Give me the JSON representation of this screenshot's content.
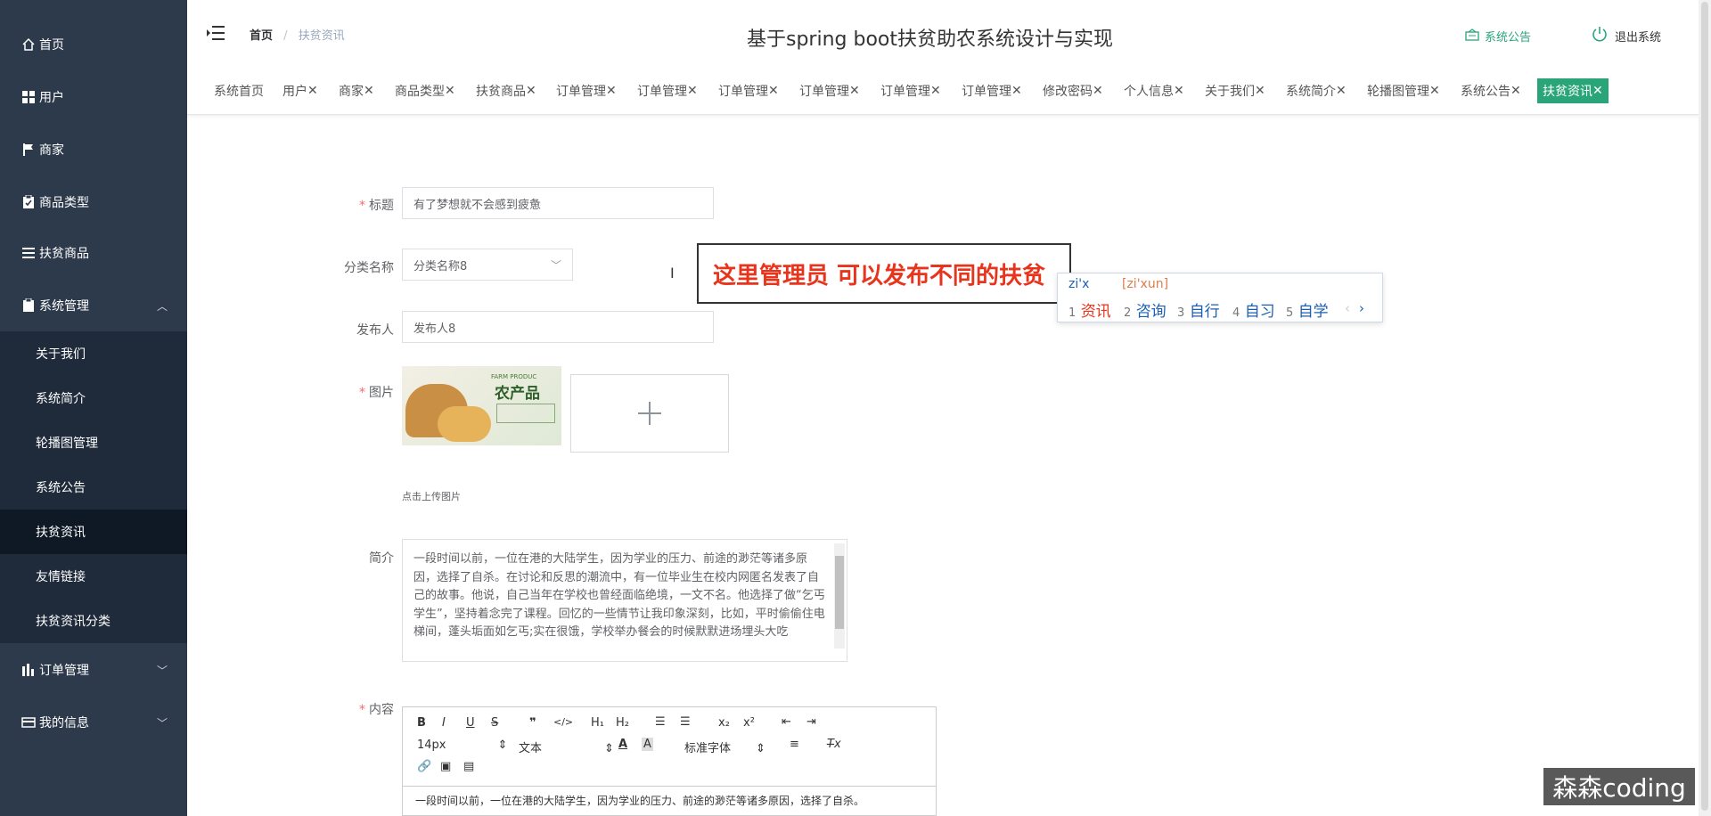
{
  "sidebar": {
    "items": [
      {
        "label": "首页",
        "icon": "home-icon"
      },
      {
        "label": "用户",
        "icon": "grid-icon"
      },
      {
        "label": "商家",
        "icon": "flag-icon"
      },
      {
        "label": "商品类型",
        "icon": "clipboard-icon"
      },
      {
        "label": "扶贫商品",
        "icon": "list-icon"
      },
      {
        "label": "系统管理",
        "icon": "clipboard-icon"
      },
      {
        "label": "订单管理",
        "icon": "chart-icon"
      },
      {
        "label": "我的信息",
        "icon": "card-icon"
      }
    ],
    "submenu": [
      "关于我们",
      "系统简介",
      "轮播图管理",
      "系统公告",
      "扶贫资讯",
      "友情链接",
      "扶贫资讯分类"
    ],
    "active_sub": "扶贫资讯"
  },
  "header": {
    "breadcrumb": [
      "首页",
      "扶贫资讯"
    ],
    "title": "基于spring boot扶贫助农系统设计与实现",
    "notice": "系统公告",
    "logout": "退出系统"
  },
  "tags": [
    "系统首页",
    "用户",
    "商家",
    "商品类型",
    "扶贫商品",
    "订单管理",
    "订单管理",
    "订单管理",
    "订单管理",
    "订单管理",
    "订单管理",
    "修改密码",
    "个人信息",
    "关于我们",
    "系统简介",
    "轮播图管理",
    "系统公告",
    "扶贫资讯"
  ],
  "close_glyph": "✕",
  "form": {
    "title_label": "标题",
    "title_value": "有了梦想就不会感到疲惫",
    "category_label": "分类名称",
    "category_value": "分类名称8",
    "publisher_label": "发布人",
    "publisher_value": "发布人8",
    "image_label": "图片",
    "upload_hint": "点击上传图片",
    "thumb_text_en": "FARM PRODUC",
    "thumb_text_cn": "农产品",
    "intro_label": "简介",
    "intro_text": "一段时间以前，一位在港的大陆学生，因为学业的压力、前途的渺茫等诸多原因，选择了自杀。在讨论和反思的潮流中，有一位毕业生在校内网匿名发表了自己的故事。他说，自己当年在学校也曾经面临绝境，一文不名。他选择了做“乞丐学生”，坚持着念完了课程。回忆的一些情节让我印象深刻，比如，平时偷偷住电梯间，蓬头垢面如乞丐;实在很饿，学校举办餐会的时候默默进场埋头大吃",
    "content_label": "内容",
    "content_text": "一段时间以前，一位在港的大陆学生，因为学业的压力、前途的渺茫等诸多原因，选择了自杀。"
  },
  "editor": {
    "font_size": "14px",
    "block": "文本",
    "font": "标准字体"
  },
  "callout": "这里管理员 可以发布不同的扶贫",
  "ime": {
    "input": "zi'x",
    "pinyin": "[zi'xun]",
    "candidates": [
      {
        "n": "1",
        "w": "资讯"
      },
      {
        "n": "2",
        "w": "咨询"
      },
      {
        "n": "3",
        "w": "自行"
      },
      {
        "n": "4",
        "w": "自习"
      },
      {
        "n": "5",
        "w": "自学"
      }
    ]
  },
  "watermark": "森森coding",
  "colors": {
    "sidebar": "#2d3a4b",
    "accent": "#2aa57a",
    "required": "#f56c6c",
    "callout": "#e8341c"
  }
}
